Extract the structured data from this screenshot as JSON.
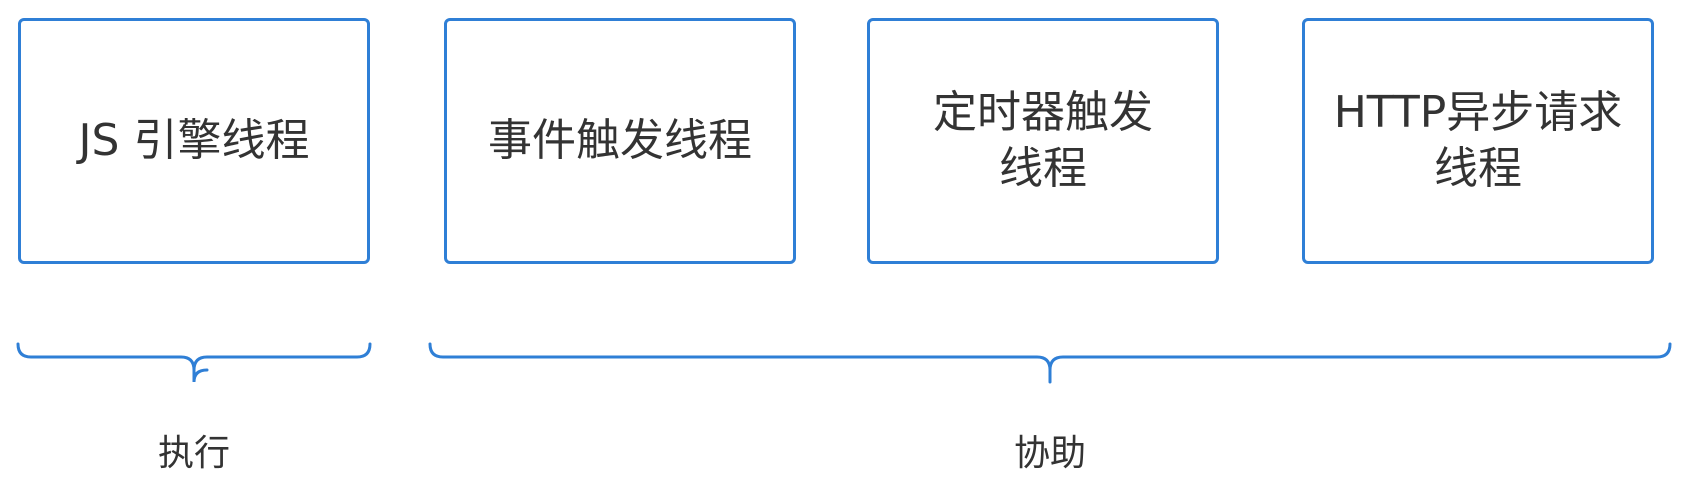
{
  "boxes": [
    {
      "label": "JS 引擎线程"
    },
    {
      "label": "事件触发线程"
    },
    {
      "label": "定时器触发\n线程"
    },
    {
      "label": "HTTP异步请求\n线程"
    }
  ],
  "groups": [
    {
      "label": "执行"
    },
    {
      "label": "协助"
    }
  ],
  "colors": {
    "accent": "#2f7fd6",
    "text": "#333333"
  }
}
